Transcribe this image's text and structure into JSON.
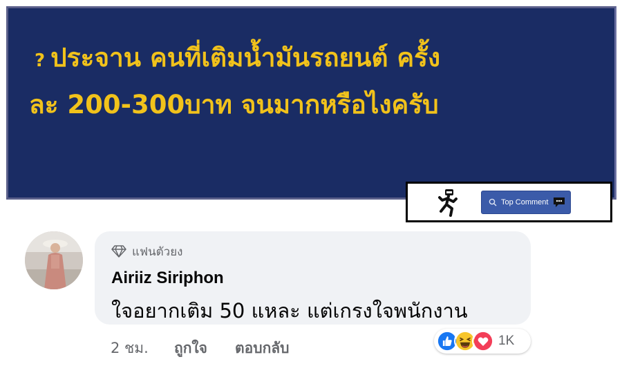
{
  "banner": {
    "icon": "question-mark",
    "line1": "ประจาน คนที่เติมน้ำมันรถยนต์ ครั้ง",
    "line2": "ละ 200-300บาท จนมากหรือไงครับ",
    "colors": {
      "background": "#1a2c64",
      "text": "#f1c21b"
    }
  },
  "top_comment": {
    "label": "Top Comment",
    "icons": [
      "runner-icon",
      "search-icon",
      "chat-bubble-icon"
    ],
    "button_color": "#3b5ba9"
  },
  "comment": {
    "badge": "แฟนตัวยง",
    "badge_icon": "diamond-icon",
    "author": "Airiiz Siriphon",
    "text": "ใจอยากเติม 50  แหละ แต่เกรงใจพนักงาน",
    "time": "2 ชม.",
    "like_label": "ถูกใจ",
    "reply_label": "ตอบกลับ",
    "reactions": [
      "like",
      "haha",
      "love"
    ],
    "reaction_count": "1K"
  }
}
